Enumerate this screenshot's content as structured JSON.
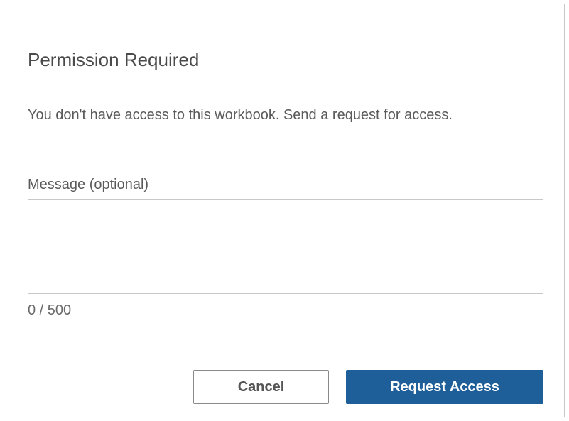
{
  "dialog": {
    "title": "Permission Required",
    "description": "You don't have access to this workbook. Send a request for access.",
    "message": {
      "label": "Message (optional)",
      "value": "",
      "placeholder": "",
      "counter": "0 / 500"
    },
    "buttons": {
      "cancel_label": "Cancel",
      "request_label": "Request Access"
    }
  },
  "colors": {
    "primary": "#1f5f99",
    "border": "#c8c8c8",
    "text": "#555555"
  }
}
